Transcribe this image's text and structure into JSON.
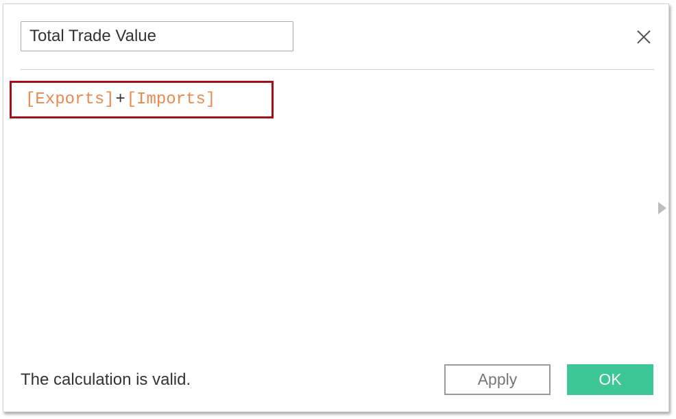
{
  "calculation": {
    "name": "Total Trade Value",
    "formula_tokens": {
      "field1": "[Exports]",
      "operator": "+",
      "field2": "[Imports]"
    },
    "status": "The calculation is valid."
  },
  "buttons": {
    "apply": "Apply",
    "ok": "OK"
  },
  "icons": {
    "close": "close-icon",
    "expand": "chevron-right-icon"
  },
  "colors": {
    "field_token": "#e8894d",
    "highlight_border": "#a50f15",
    "ok_button": "#3dc796"
  }
}
